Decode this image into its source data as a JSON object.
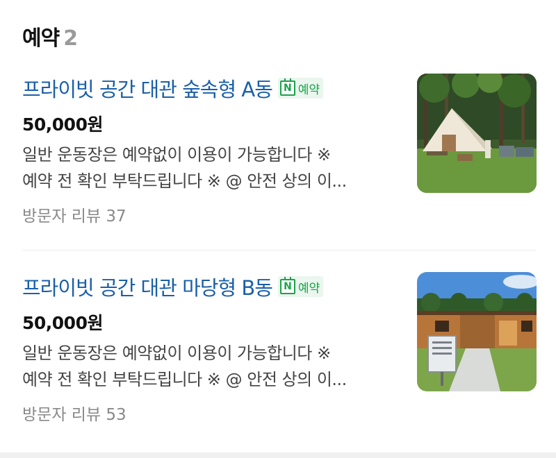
{
  "section": {
    "title": "예약",
    "count": "2"
  },
  "badge_label": "예약",
  "badge_icon": "naver-booking-calendar-icon",
  "badge_letter": "N",
  "items": [
    {
      "name": "프라이빗 공간 대관 숲속형 A동",
      "price": "50,000원",
      "desc_line1": "일반 운동장은 예약없이 이용이 가능합니다 ※",
      "desc_line2": "예약 전 확인 부탁드립니다 ※ @ 안전 상의 이...",
      "review": "방문자 리뷰 37",
      "image": "tent-glamping-photo"
    },
    {
      "name": "프라이빗 공간 대관 마당형 B동",
      "price": "50,000원",
      "desc_line1": "일반 운동장은 예약없이 이용이 가능합니다 ※",
      "desc_line2": "예약 전 확인 부탁드립니다 ※ @ 안전 상의 이...",
      "review": "방문자 리뷰 53",
      "image": "wooden-cabin-photo"
    }
  ],
  "colors": {
    "link": "#1a5fa8",
    "naver_green": "#1aa34a",
    "muted": "#888888"
  }
}
